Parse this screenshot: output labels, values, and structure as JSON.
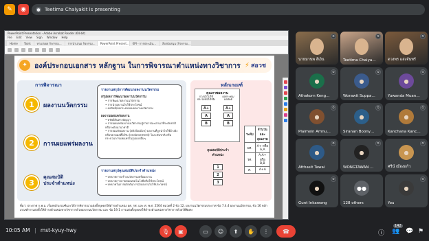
{
  "top_bar": {
    "presenting_text": "Teetima Chaiyakit is presenting"
  },
  "shared_window": {
    "title": "PowerPoint Presentation - Adobe Acrobat Reader (64-bit)",
    "menu": [
      "File",
      "Edit",
      "View",
      "Sign",
      "Window",
      "Help"
    ],
    "tabs": [
      "Home",
      "Tools",
      "ทามส่งผล กิจกรรม...",
      "การนำเสนอ กิจกรรม...",
      "PowerPoint Present...",
      "KPI - การประเมิน...",
      "สิ่งสนับสนุน (กิจกรรม..."
    ]
  },
  "slide": {
    "title": "องค์ประกอบเอกสาร หลักฐาน ในการพิจารณาตำแหน่งทางวิชาการ",
    "logo_text": "สอวช",
    "left_header": "การพิจารณา",
    "right_header": "หลักเกณฑ์",
    "items": [
      {
        "num": "1",
        "label": "ผลงานนวัตกรรม"
      },
      {
        "num": "2",
        "label": "การเผยแพร่ผลงาน"
      },
      {
        "num": "3",
        "label": "คุณสมบัติ",
        "label2": "ประจำตำแหน่ง"
      }
    ],
    "box1": {
      "heading": "รายงานสรุปการพัฒนาผลงานนวัตกรรม",
      "sub": "สรุปผลการพัฒนาผลงานนวัตกรรม",
      "lines": [
        "การพัฒนาผลงานนวัตกรรม",
        "การนำผลงานไปใช้ประโยชน์",
        "ผลลัพธ์/ผลกระทบของผลงานนวัตกรรม"
      ]
    },
    "box2": {
      "sub": "ผลงานเผยแพร่ผลงาน",
      "lines": [
        "ทรัพย์สินทางปัญญา",
        "การเผยแพร่ผลงานนวัตกรรมสู่สาธารณะผ่านเวทีระดับชาติ หรือระดับนานาชาติ",
        "การยอมรับผลงาน (attribution) ผลงานที่ถูกนำไปใช้อ้างอิงหรือขยายผลที่ได้รับ (endorsement) ในระดับชาติ หรือกระบวนการเผยแพร่ในรูปแบบอื่นๆ"
      ]
    },
    "box3": {
      "heading": "รายงานสรุปคุณสมบัติประจำตำแหน่ง",
      "lines": [
        "บทบาทการสร้างนวัตกรรมหรือผลงาน",
        "บทบาทการถ่ายทอดเทคโนโลยีหรือใช้ประโยชน์",
        "บทบาทในการผลักดันการนำผลงานไปใช้ประโยชน์"
      ]
    },
    "criteria": {
      "quality_heading": "คุณภาพผลงาน",
      "col_a": "การนำไปใช้ประโยชน์ได้จริง",
      "col_b": "ผลกระทบ/ผลลัพธ์",
      "grades_a": [
        "A+",
        "A",
        "B"
      ],
      "grades_b": [
        "A+",
        "A",
        "B"
      ],
      "qual_heading": "คุณสมบัติประจำตำแหน่ง",
      "qual_levels": [
        "1",
        "2",
        "3"
      ],
      "table_headers": [
        "ระดับ",
        "จำนวนและคุณภาพ"
      ],
      "table_rows": [
        [
          "ผศ.",
          "A+ หรือ A,A"
        ],
        [
          "รศ.",
          "A,A+ หรือ B,B"
        ],
        [
          "ศ.",
          "A+A"
        ]
      ]
    },
    "footnote": "ที่มา: ประกาศ ก.พ.อ. เรื่องหลักเกณฑ์และวิธีการพิจารณาแต่งตั้งบุคคลให้ดำรงตำแหน่ง ผศ. รศ. และ ศ. พ.ศ. 2564 หมวดที่ 2 ข้อ 12, ผลงานนวัตกรรมประกาศ ข้อ 7.4.4 ผลงานนวัตกรรม, ข้อ 16 หลักเกณฑ์การแต่งตั้งให้ดำรงตำแหน่งทางวิชาการด้วยผลงานนวัตกรรม และ ข้อ 19.1 การแต่งตั้งบุคคลให้ดำรงตำแหน่งทางวิชาการด้วยวิธีพิเศษ"
  },
  "participants": [
    {
      "name": "นายมานพ สีเงิน",
      "kind": "video",
      "color": "#8a6d4c"
    },
    {
      "name": "Teetima Chaiyakit",
      "kind": "video",
      "color": "#c9a58a"
    },
    {
      "name": "ดวงพร แสงจันทร์",
      "kind": "video",
      "color": "#7b5a3c"
    },
    {
      "name": "Athakorn Kengpol",
      "kind": "avatar",
      "color": "#1b6f4a"
    },
    {
      "name": "Worawit Suppaw...",
      "kind": "avatar",
      "color": "#3b5b8c"
    },
    {
      "name": "Yuwanda Muangi...",
      "kind": "avatar",
      "color": "#6d4a9b"
    },
    {
      "name": "Plaimein Amnua...",
      "kind": "avatar",
      "color": "#805030"
    },
    {
      "name": "Siranan Boonyap...",
      "kind": "avatar",
      "color": "#2c5f8a"
    },
    {
      "name": "Kanchana Kanch...",
      "kind": "avatar",
      "color": "#b07a3a"
    },
    {
      "name": "Atthasit Tawai",
      "kind": "avatar",
      "color": "#2e5a87"
    },
    {
      "name": "WONGTAWAN U...",
      "kind": "avatar",
      "color": "#222222"
    },
    {
      "name": "ศรีน์ เมืองแก้ว",
      "kind": "avatar",
      "color": "#c89550"
    },
    {
      "name": "Gunt Inkawong",
      "kind": "avatar",
      "color": "#111111"
    },
    {
      "name": "128 others",
      "kind": "others",
      "color": "#5f6368"
    },
    {
      "name": "You",
      "kind": "avatar",
      "color": "#3a3a3a"
    }
  ],
  "bottom_bar": {
    "time": "10:05 AM",
    "separator": "|",
    "meeting_code": "mst-kyuy-hwy",
    "participant_count": "142"
  },
  "colors": {
    "accent_red": "#ea4335",
    "title_navy": "#1a2e6b",
    "number_gold": "#f5b800"
  }
}
